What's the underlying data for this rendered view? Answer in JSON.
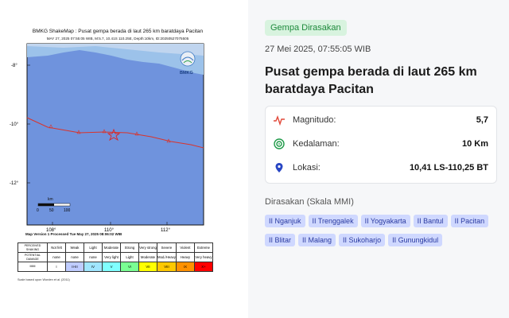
{
  "map": {
    "title": "BMKG ShakeMap : Pusat gempa berada di laut 265 km baratdaya Pacitan",
    "subtitle": "MAY 27, 2025 07:55:05 WIB, M:5.7, 10.41S 110.25E, Depth:10km, ID:20250527075505",
    "lat_labels": [
      "-8°",
      "-10°",
      "-12°"
    ],
    "lon_labels": [
      "108°",
      "110°",
      "112°"
    ],
    "scale_unit": "km",
    "scale_ticks": [
      "0",
      "50",
      "100"
    ],
    "logo_text": "BMKG",
    "processed": "Map Version 1 Processed Tue May 27, 2025 08:06:02 WIB",
    "based_on": "Scale based upon Worden et al. (2011)",
    "colors": {
      "sea": "#6f93dd",
      "land": "#8fb6e6",
      "fault": "#d9342c",
      "border": "#111111"
    }
  },
  "mmi_table": {
    "row_labels": [
      "PERCEIVED SHAKING",
      "POTENTIAL DAMAGE",
      "MMI"
    ],
    "shaking": [
      "Not felt",
      "Weak",
      "Light",
      "Moderate",
      "Strong",
      "Very strong",
      "Severe",
      "Violent",
      "Extreme"
    ],
    "damage": [
      "none",
      "none",
      "none",
      "Very light",
      "Light",
      "Moderate",
      "Mod./Heavy",
      "Heavy",
      "Very heavy"
    ],
    "mmi": [
      "I",
      "II-III",
      "IV",
      "V",
      "VI",
      "VII",
      "VIII",
      "IX",
      "X+"
    ],
    "mmi_colors": [
      "#ffffff",
      "#bfccff",
      "#a0e6ff",
      "#80ffff",
      "#7aff93",
      "#ffff00",
      "#ffc800",
      "#ff9100",
      "#ff0000"
    ]
  },
  "badge": "Gempa Dirasakan",
  "date": "27 Mei 2025, 07:55:05 WIB",
  "headline": "Pusat gempa berada di laut 265 km baratdaya Pacitan",
  "details": {
    "magnitude_label": "Magnitudo:",
    "magnitude_value": "5,7",
    "depth_label": "Kedalaman:",
    "depth_value": "10 Km",
    "location_label": "Lokasi:",
    "location_value": "10,41 LS-110,25 BT"
  },
  "felt": {
    "heading": "Dirasakan (Skala MMI)",
    "items": [
      "II Nganjuk",
      "II Trenggalek",
      "II Yogyakarta",
      "II Bantul",
      "II Pacitan",
      "II Blitar",
      "II Malang",
      "II Sukoharjo",
      "II Gunungkidul"
    ]
  }
}
